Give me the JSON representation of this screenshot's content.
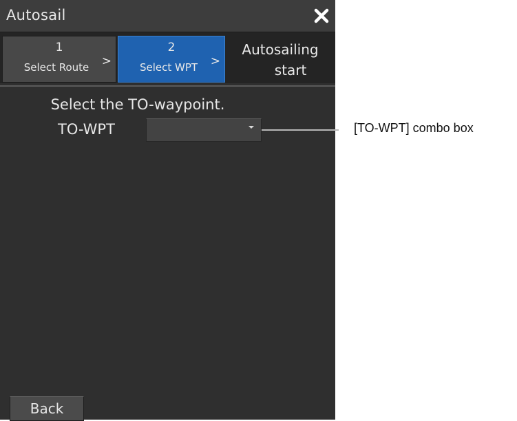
{
  "window": {
    "title": "Autosail",
    "close_icon": "close-icon"
  },
  "steps": [
    {
      "number": "1",
      "label": "Select Route",
      "arrow": ">",
      "active": false
    },
    {
      "number": "2",
      "label": "Select WPT",
      "arrow": ">",
      "active": true
    },
    {
      "line1": "Autosailing",
      "line2": "start",
      "active": false
    }
  ],
  "main": {
    "instruction": "Select the TO-waypoint.",
    "to_wpt_label": "TO-WPT",
    "to_wpt_value": ""
  },
  "footer": {
    "back_label": "Back"
  },
  "annotation": {
    "callout": "[TO-WPT] combo box"
  },
  "colors": {
    "panel_bg": "#2f2f2f",
    "active_step": "#1f62b0",
    "text": "#e6e6e6"
  }
}
